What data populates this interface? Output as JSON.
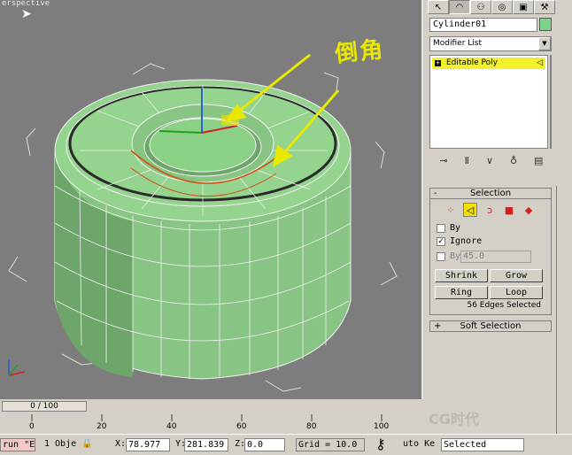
{
  "viewport": {
    "label": "erspective",
    "annotation": "倒角"
  },
  "command_panel": {
    "tabs": [
      "create",
      "modify",
      "hierarchy",
      "motion",
      "display",
      "utilities"
    ],
    "object_name": "Cylinder01",
    "object_color": "#7cd487",
    "modifier_list": "Modifier List",
    "stack_items": [
      {
        "label": "Editable Poly"
      }
    ],
    "selection_rollout": {
      "title": "Selection",
      "sign": "-",
      "by_label": "By",
      "ignore_label": "Ignore",
      "by_angle_label": "By",
      "angle_value": "45.0",
      "shrink_label": "Shrink",
      "grow_label": "Grow",
      "ring_label": "Ring",
      "loop_label": "Loop",
      "status": "56 Edges Selected"
    },
    "soft_selection_rollout": {
      "title": "Soft Selection",
      "sign": "+"
    }
  },
  "timeline": {
    "frame_display": "0 / 100",
    "ticks": [
      "0",
      "20",
      "40",
      "60",
      "80",
      "100"
    ]
  },
  "status_bar": {
    "script": "run \"E",
    "objects": "1 Obje",
    "x_label": "X:",
    "x_value": "78.977",
    "y_label": "Y:",
    "y_value": "281.839",
    "z_label": "Z:",
    "z_value": "0.0",
    "grid": "Grid = 10.0",
    "autokey": "uto Ke",
    "selected": "Selected"
  },
  "watermark": "CG时代",
  "colors": {
    "viewport_bg": "#7d7d7d",
    "mesh_green": "#8fcf8a",
    "arrow_yellow": "#e8e800",
    "active_yellow": "#f2e000"
  }
}
